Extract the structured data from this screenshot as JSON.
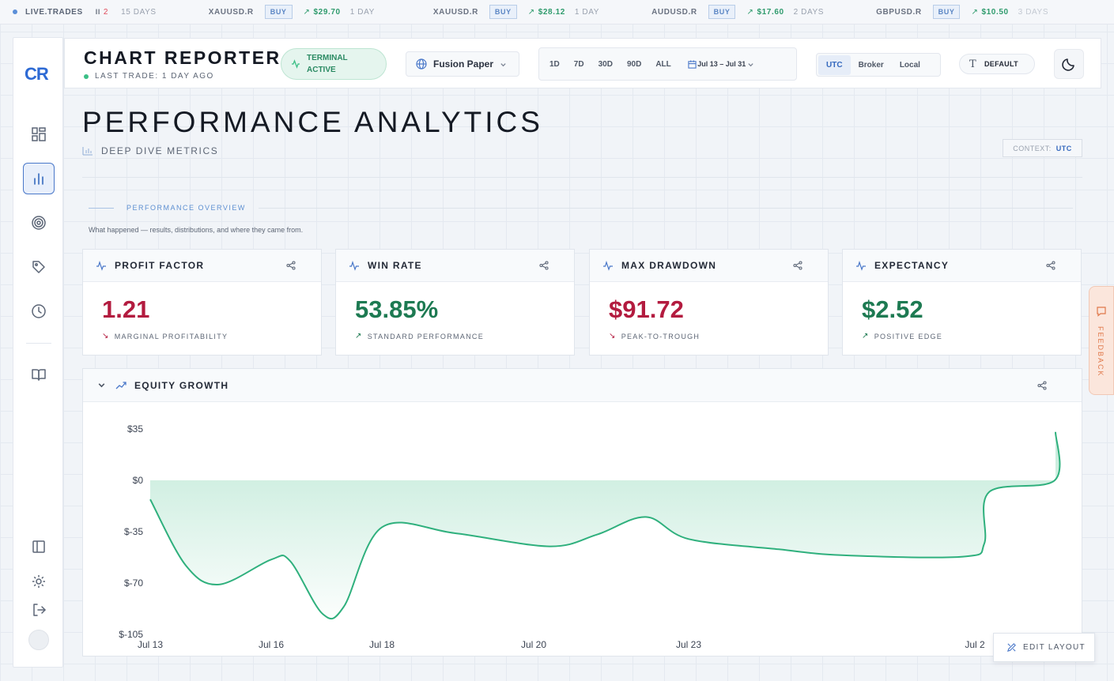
{
  "ticker": {
    "live_label": "LIVE.TRADES",
    "pause_glyph": "II",
    "count": "2",
    "first_age": "15 DAYS",
    "items": [
      {
        "symbol": "XAUUSD.R",
        "side": "BUY",
        "value": "$29.70",
        "age": "1 DAY"
      },
      {
        "symbol": "XAUUSD.R",
        "side": "BUY",
        "value": "$28.12",
        "age": "1 DAY"
      },
      {
        "symbol": "AUDUSD.R",
        "side": "BUY",
        "value": "$17.60",
        "age": "2 DAYS"
      },
      {
        "symbol": "GBPUSD.R",
        "side": "BUY",
        "value": "$10.50",
        "age": "3 DAYS"
      }
    ]
  },
  "sidebar": {
    "logo": "CR"
  },
  "header": {
    "title": "CHART REPORTER",
    "last_trade": "LAST TRADE: 1 DAY AGO",
    "terminal_status": "TERMINAL ACTIVE",
    "account": "Fusion Paper",
    "ranges": [
      "1D",
      "7D",
      "30D",
      "90D",
      "ALL"
    ],
    "date_range": "Jul 13 – Jul 31",
    "timezones": [
      "UTC",
      "Broker",
      "Local"
    ],
    "active_timezone": "UTC",
    "font_preset": "DEFAULT"
  },
  "page": {
    "title": "PERFORMANCE ANALYTICS",
    "subtitle": "DEEP DIVE METRICS",
    "context_label": "CONTEXT:",
    "context_value": "UTC",
    "section_label": "PERFORMANCE OVERVIEW",
    "section_desc": "What happened — results, distributions, and where they came from."
  },
  "kpis": [
    {
      "title": "PROFIT FACTOR",
      "value": "1.21",
      "note": "MARGINAL PROFITABILITY",
      "tone": "neg"
    },
    {
      "title": "WIN RATE",
      "value": "53.85%",
      "note": "STANDARD PERFORMANCE",
      "tone": "pos"
    },
    {
      "title": "MAX DRAWDOWN",
      "value": "$91.72",
      "note": "PEAK-TO-TROUGH",
      "tone": "neg"
    },
    {
      "title": "EXPECTANCY",
      "value": "$2.52",
      "note": "POSITIVE EDGE",
      "tone": "pos"
    }
  ],
  "chart_panel": {
    "title": "EQUITY GROWTH"
  },
  "chart_data": {
    "type": "area",
    "title": "",
    "xlabel": "",
    "ylabel": "",
    "yticks": [
      "$35",
      "$0",
      "$-35",
      "$-70",
      "$-105"
    ],
    "ytick_values": [
      35,
      0,
      -35,
      -70,
      -105
    ],
    "ylim": [
      -105,
      35
    ],
    "xticks": [
      "Jul 13",
      "Jul 16",
      "Jul 18",
      "Jul 20",
      "Jul 23",
      "Jul 2"
    ],
    "grid": false,
    "colors": {
      "line": "#2fb07d",
      "fill": "#bfe9d7"
    },
    "series": [
      {
        "x": [
          "Jul 13",
          "Jul 14",
          "Jul 15",
          "Jul 16",
          "Jul 16",
          "Jul 17",
          "Jul 17",
          "Jul 18",
          "Jul 19",
          "Jul 20",
          "Jul 21",
          "Jul 22",
          "Jul 23",
          "Jul 25",
          "Jul 27",
          "Jul 29",
          "Jul 30",
          "Jul 30",
          "Jul 31",
          "Jul 31"
        ],
        "values": [
          -13,
          -58,
          -71,
          -54,
          -55,
          -91,
          -86,
          -32,
          -36,
          -45,
          -37,
          -25,
          -40,
          -47,
          -51,
          -52,
          -43,
          -8,
          0,
          33
        ]
      }
    ]
  },
  "feedback_label": "FEEDBACK",
  "edit_layout_label": "EDIT LAYOUT"
}
